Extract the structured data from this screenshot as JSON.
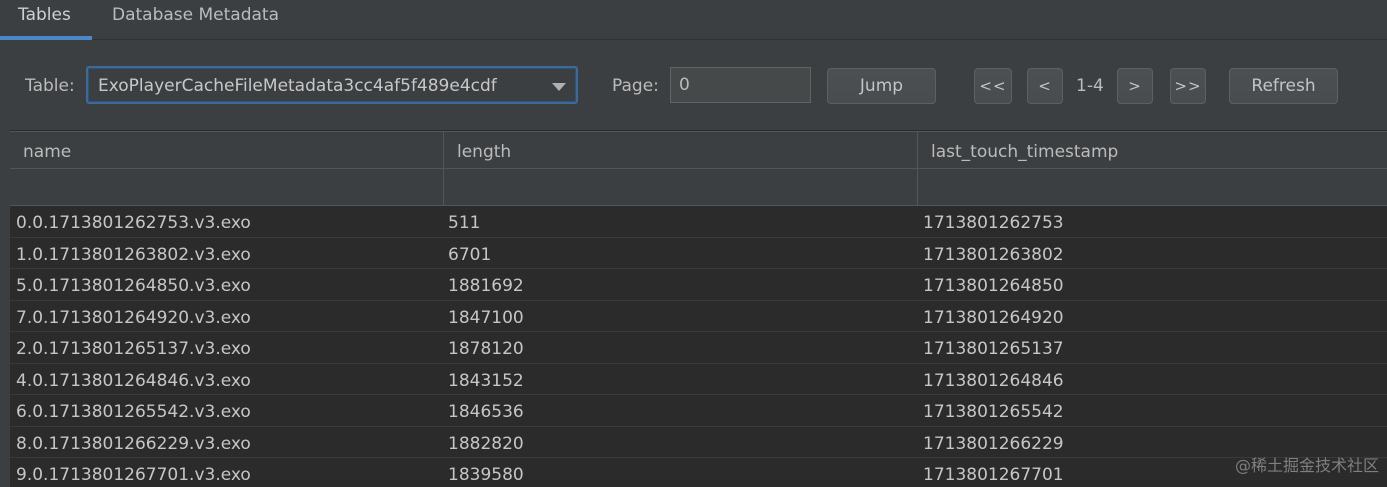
{
  "tabs": [
    {
      "label": "Tables",
      "active": true
    },
    {
      "label": "Database Metadata",
      "active": false
    }
  ],
  "toolbar": {
    "table_label": "Table:",
    "table_selected": "ExoPlayerCacheFileMetadata3cc4af5f489e4cdf",
    "page_label": "Page:",
    "page_value": "0",
    "jump_label": "Jump",
    "first_label": "<<",
    "prev_label": "<",
    "range_text": "1-4",
    "next_label": ">",
    "last_label": ">>",
    "refresh_label": "Refresh"
  },
  "table": {
    "columns": [
      "name",
      "length",
      "last_touch_timestamp"
    ],
    "rows": [
      [
        "0.0.1713801262753.v3.exo",
        "511",
        "1713801262753"
      ],
      [
        "1.0.1713801263802.v3.exo",
        "6701",
        "1713801263802"
      ],
      [
        "5.0.1713801264850.v3.exo",
        "1881692",
        "1713801264850"
      ],
      [
        "7.0.1713801264920.v3.exo",
        "1847100",
        "1713801264920"
      ],
      [
        "2.0.1713801265137.v3.exo",
        "1878120",
        "1713801265137"
      ],
      [
        "4.0.1713801264846.v3.exo",
        "1843152",
        "1713801264846"
      ],
      [
        "6.0.1713801265542.v3.exo",
        "1846536",
        "1713801265542"
      ],
      [
        "8.0.1713801266229.v3.exo",
        "1882820",
        "1713801266229"
      ],
      [
        "9.0.1713801267701.v3.exo",
        "1839580",
        "1713801267701"
      ]
    ]
  },
  "watermark": "@稀土掘金技术社区",
  "colors": {
    "background": "#3c3f41",
    "table_background": "#2b2b2b",
    "accent": "#4a88c7"
  },
  "icons": {
    "combo_arrow": "chevron-down-icon"
  }
}
